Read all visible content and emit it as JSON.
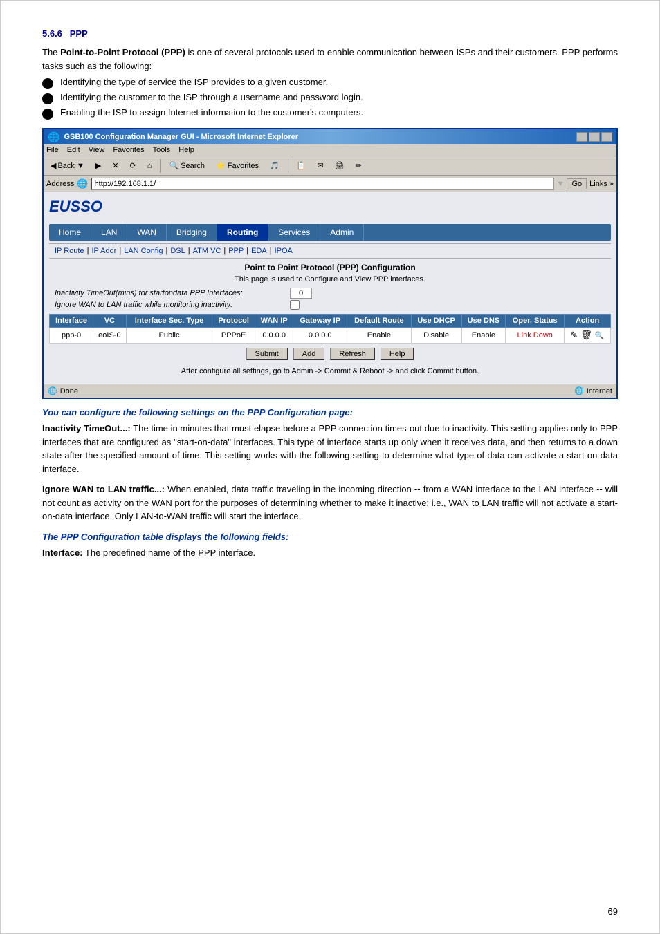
{
  "section": {
    "number": "5.6.6",
    "title": "PPP",
    "intro": "The Point-to-Point Protocol (PPP) is one of several protocols used to enable communication between ISPs and their customers. PPP performs tasks such as the following:",
    "intro_bold": "Point-to-Point Protocol (PPP)",
    "bullets": [
      "Identifying the type of service the ISP provides to a given customer.",
      "Identifying the customer to the ISP through a username and password login.",
      "Enabling the ISP to assign Internet information to the customer's computers."
    ]
  },
  "ie_window": {
    "title": "GSB100 Configuration Manager GUI - Microsoft Internet Explorer",
    "title_icon": "🌐",
    "buttons": {
      "submit": "Submit",
      "add": "Add",
      "refresh": "Refresh",
      "help": "Help"
    },
    "menubar": [
      "File",
      "Edit",
      "View",
      "Favorites",
      "Tools",
      "Help"
    ],
    "toolbar": {
      "back": "Back",
      "forward": "",
      "stop": "✕",
      "refresh": "⟳",
      "home": "⌂",
      "search": "Search",
      "favorites": "Favorites",
      "media": "🎵",
      "history": "⌚"
    },
    "address": {
      "label": "Address",
      "value": "http://192.168.1.1/",
      "go": "Go",
      "links": "Links »"
    },
    "logo": "EUSSO",
    "nav": {
      "items": [
        "Home",
        "LAN",
        "WAN",
        "Bridging",
        "Routing",
        "Services",
        "Admin"
      ],
      "active": "Routing"
    },
    "subnav": {
      "items": [
        "IP Route",
        "IP Addr",
        "LAN Config",
        "DSL",
        "ATM VC",
        "PPP",
        "EDA",
        "IPOA"
      ],
      "separator": "|"
    },
    "page_title": "Point to Point Protocol (PPP) Configuration",
    "page_subtitle": "This page is used to Configure and View PPP interfaces.",
    "config": {
      "timeout_label": "Inactivity TimeOut(mins) for startondata PPP Interfaces:",
      "timeout_value": "0",
      "ignore_label": "Ignore WAN to LAN traffic while monitoring inactivity:",
      "ignore_checked": false
    },
    "table": {
      "headers": [
        "Interface",
        "VC",
        "Interface Sec. Type",
        "Protocol",
        "WAN IP",
        "Gateway IP",
        "Default Route",
        "Use DHCP",
        "Use DNS",
        "Oper. Status",
        "Action"
      ],
      "rows": [
        {
          "interface": "ppp-0",
          "vc": "eoIS-0",
          "interface_sec_type": "Public",
          "protocol": "PPPoE",
          "wan_ip": "0.0.0.0",
          "gateway_ip": "0.0.0.0",
          "default_route": "Enable",
          "use_dhcp": "Disable",
          "use_dns": "Enable",
          "oper_status": "Link Down",
          "action_edit": "✎",
          "action_delete": "🗑",
          "action_connect": "🔍"
        }
      ]
    },
    "footer_note": "After configure all settings, go to Admin -> Commit & Reboot -> and click Commit button.",
    "statusbar": {
      "status": "Done",
      "zone": "Internet"
    }
  },
  "ppp_config_heading": "You can configure the following settings on the PPP Configuration page:",
  "descriptions": [
    {
      "term": "Inactivity TimeOut...:",
      "text": " The time in minutes that must elapse before a PPP connection times-out due to inactivity. This setting applies only to PPP interfaces that are configured as \"start-on-data\" interfaces. This type of interface starts up only when it receives data, and then returns to a down state after the specified amount of time. This setting works with the following setting to determine what type of data can activate a start-on-data interface."
    },
    {
      "term": "Ignore WAN to LAN traffic...:",
      "text": " When enabled, data traffic traveling in the incoming direction -- from a WAN interface to the LAN interface -- will not count as activity on the WAN port for the purposes of determining whether to make it inactive; i.e., WAN to LAN traffic will not activate a start-on-data interface. Only LAN-to-WAN traffic will start the interface."
    }
  ],
  "ppp_table_heading": "The PPP Configuration table displays the following fields:",
  "interface_desc": {
    "term": "Interface:",
    "text": " The predefined name of the PPP interface."
  },
  "page_number": "69"
}
